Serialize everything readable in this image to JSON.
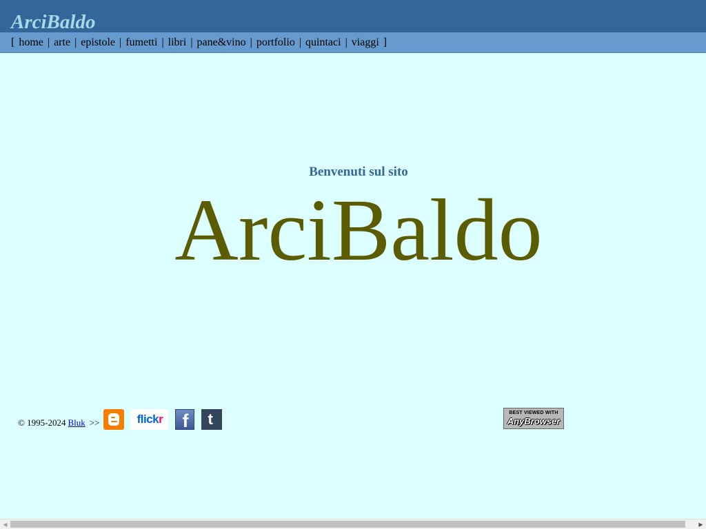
{
  "header": {
    "logo": "ArciBaldo"
  },
  "nav": {
    "open_bracket": "[",
    "close_bracket": "]",
    "separator": "|",
    "items": [
      {
        "label": "home"
      },
      {
        "label": "arte"
      },
      {
        "label": "epistole"
      },
      {
        "label": "fumetti"
      },
      {
        "label": "libri"
      },
      {
        "label": "pane&vino"
      },
      {
        "label": "portfolio"
      },
      {
        "label": "quintaci"
      },
      {
        "label": "viaggi"
      }
    ]
  },
  "main": {
    "welcome": "Benvenuti sul sito",
    "title": "ArciBaldo"
  },
  "footer": {
    "copyright": "© 1995-2024",
    "author_link": "Bluk",
    "arrows": ">>",
    "social": {
      "blogger_icon": "blogger-icon",
      "flickr_text_fl": "flick",
      "flickr_text_r": "r",
      "facebook_letter": "f",
      "tumblr_letter": "t"
    },
    "badge": {
      "top": "BEST VIEWED WITH",
      "bottom": "AnyBrowser"
    }
  },
  "colors": {
    "header_bg": "#336699",
    "nav_bg": "#6699cc",
    "page_bg": "#dcffff",
    "logo": "#a9d8e6",
    "welcome": "#336699",
    "title": "#5b5b00"
  }
}
